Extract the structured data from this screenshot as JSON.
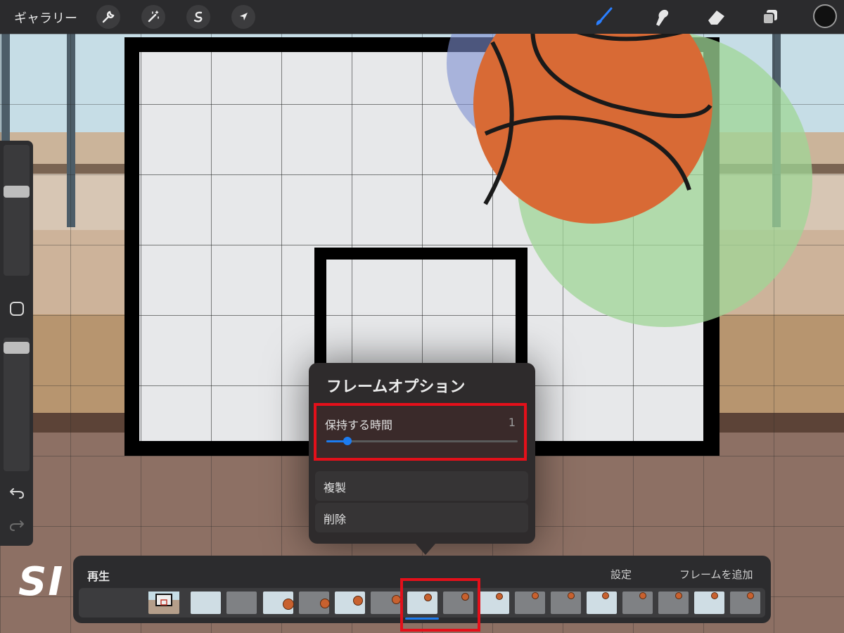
{
  "topbar": {
    "gallery_label": "ギャラリー",
    "tools": [
      "wrench-icon",
      "magic-wand-icon",
      "selection-s-icon",
      "transform-arrow-icon"
    ],
    "right_tools": [
      "brush-icon",
      "smudge-icon",
      "eraser-icon",
      "layers-icon"
    ],
    "brush_active_color": "#2a7fff",
    "current_color": "#111111"
  },
  "sidebar": {
    "brush_size_slider": "brush-size",
    "opacity_slider": "opacity",
    "modify_button": "square-modify",
    "undo": "undo-icon",
    "redo": "redo-icon"
  },
  "popover": {
    "title": "フレームオプション",
    "hold_duration_label": "保持する時間",
    "hold_duration_value": "1",
    "hold_slider_fraction": 0.11,
    "duplicate_label": "複製",
    "delete_label": "削除"
  },
  "timeline": {
    "play_label": "再生",
    "settings_label": "設定",
    "add_frame_label": "フレームを追加",
    "selected_frame_index": 8,
    "accent": "#1c7cf0"
  },
  "highlight_color": "#e4101a"
}
